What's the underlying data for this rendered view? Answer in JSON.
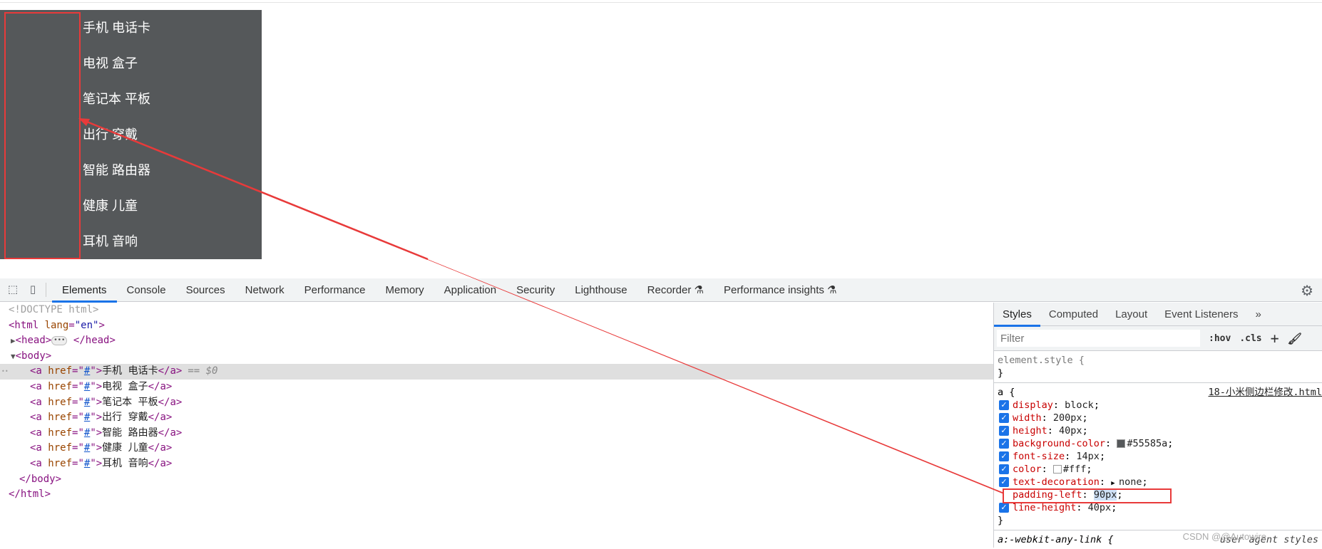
{
  "page": {
    "sidebar_items": [
      "手机 电话卡",
      "电视 盒子",
      "笔记本 平板",
      "出行 穿戴",
      "智能 路由器",
      "健康 儿童",
      "耳机 音响"
    ],
    "sidebar_bg": "#55585a",
    "annotation_color": "#e83a3a"
  },
  "devtools": {
    "tabs": [
      "Elements",
      "Console",
      "Sources",
      "Network",
      "Performance",
      "Memory",
      "Application",
      "Security",
      "Lighthouse",
      "Recorder ⚗",
      "Performance insights ⚗"
    ],
    "active_tab": "Elements",
    "elements": {
      "doctype": "<!DOCTYPE html>",
      "html_open": "<html lang=\"en\">",
      "head": "<head>",
      "head_close": "</head>",
      "body_open": "<body>",
      "links": [
        "手机 电话卡",
        "电视 盒子",
        "笔记本 平板",
        "出行 穿戴",
        "智能 路由器",
        "健康 儿童",
        "耳机 音响"
      ],
      "selected_marker": "== $0",
      "body_close": "</body>",
      "html_close": "</html>"
    },
    "styles": {
      "tabs": [
        "Styles",
        "Computed",
        "Layout",
        "Event Listeners",
        "»"
      ],
      "filter_placeholder": "Filter",
      "hov": ":hov",
      "cls": ".cls",
      "element_style": "element.style {",
      "rule_selector": "a {",
      "rule_source": "18-小米侧边栏修改.html",
      "props": [
        {
          "name": "display",
          "value": "block",
          "checked": true
        },
        {
          "name": "width",
          "value": "200px",
          "checked": true
        },
        {
          "name": "height",
          "value": "40px",
          "checked": true
        },
        {
          "name": "background-color",
          "value": "#55585a",
          "checked": true,
          "swatch": "#55585a"
        },
        {
          "name": "font-size",
          "value": "14px",
          "checked": true
        },
        {
          "name": "color",
          "value": "#fff",
          "checked": true,
          "swatch": "#ffffff"
        },
        {
          "name": "text-decoration",
          "value": "none",
          "checked": true
        },
        {
          "name": "padding-left",
          "value": "90px",
          "checked": false
        },
        {
          "name": "line-height",
          "value": "40px",
          "checked": true
        }
      ],
      "next_rule": "a:-webkit-any-link {",
      "next_source": "user agent styles"
    }
  },
  "watermark": "CSDN @@Autowire"
}
